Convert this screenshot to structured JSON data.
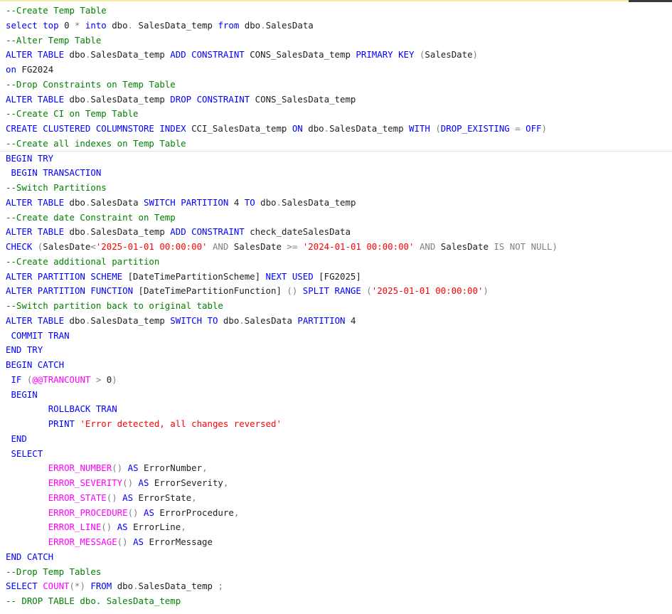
{
  "editor": {
    "lines": [
      {
        "indent": "",
        "tokens": [
          {
            "t": "--Create Temp Table",
            "c": "cm"
          }
        ]
      },
      {
        "indent": "",
        "tokens": [
          {
            "t": "select top ",
            "c": "kw"
          },
          {
            "t": "0 ",
            "c": "id"
          },
          {
            "t": "* ",
            "c": "op"
          },
          {
            "t": "into ",
            "c": "kw"
          },
          {
            "t": "dbo",
            "c": "id"
          },
          {
            "t": ".",
            "c": "op"
          },
          {
            "t": " SalesData_temp ",
            "c": "id"
          },
          {
            "t": "from ",
            "c": "kw"
          },
          {
            "t": "dbo",
            "c": "id"
          },
          {
            "t": ".",
            "c": "op"
          },
          {
            "t": "SalesData",
            "c": "id"
          }
        ]
      },
      {
        "indent": "",
        "tokens": [
          {
            "t": "--Alter Temp Table",
            "c": "cm"
          }
        ]
      },
      {
        "indent": "",
        "tokens": [
          {
            "t": "ALTER TABLE ",
            "c": "kw"
          },
          {
            "t": "dbo",
            "c": "id"
          },
          {
            "t": ".",
            "c": "op"
          },
          {
            "t": "SalesData_temp ",
            "c": "id"
          },
          {
            "t": "ADD CONSTRAINT ",
            "c": "kw"
          },
          {
            "t": "CONS_SalesData_temp ",
            "c": "id"
          },
          {
            "t": "PRIMARY KEY ",
            "c": "kw"
          },
          {
            "t": "(",
            "c": "op"
          },
          {
            "t": "SalesDate",
            "c": "id"
          },
          {
            "t": ")",
            "c": "op"
          }
        ]
      },
      {
        "indent": "",
        "tokens": [
          {
            "t": "on ",
            "c": "kw"
          },
          {
            "t": "FG2024",
            "c": "id"
          }
        ]
      },
      {
        "indent": "",
        "tokens": [
          {
            "t": "--Drop Constraints on Temp Table",
            "c": "cm"
          }
        ]
      },
      {
        "indent": "",
        "tokens": [
          {
            "t": "ALTER TABLE ",
            "c": "kw"
          },
          {
            "t": "dbo",
            "c": "id"
          },
          {
            "t": ".",
            "c": "op"
          },
          {
            "t": "SalesData_temp ",
            "c": "id"
          },
          {
            "t": "DROP CONSTRAINT ",
            "c": "kw"
          },
          {
            "t": "CONS_SalesData_temp",
            "c": "id"
          }
        ]
      },
      {
        "indent": "",
        "tokens": [
          {
            "t": "--Create CI on Temp Table",
            "c": "cm"
          }
        ]
      },
      {
        "indent": "",
        "tokens": [
          {
            "t": "CREATE CLUSTERED COLUMNSTORE INDEX ",
            "c": "kw"
          },
          {
            "t": "CCI_SalesData_temp ",
            "c": "id"
          },
          {
            "t": "ON ",
            "c": "kw"
          },
          {
            "t": "dbo",
            "c": "id"
          },
          {
            "t": ".",
            "c": "op"
          },
          {
            "t": "SalesData_temp ",
            "c": "id"
          },
          {
            "t": "WITH ",
            "c": "kw"
          },
          {
            "t": "(",
            "c": "op"
          },
          {
            "t": "DROP_EXISTING ",
            "c": "kw"
          },
          {
            "t": "= ",
            "c": "op"
          },
          {
            "t": "OFF",
            "c": "kw"
          },
          {
            "t": ")",
            "c": "op"
          }
        ]
      },
      {
        "indent": "",
        "tokens": [
          {
            "t": "--Create all indexes on Temp Table",
            "c": "cm"
          }
        ],
        "current": true
      },
      {
        "indent": "",
        "tokens": [
          {
            "t": "BEGIN TRY",
            "c": "kw"
          }
        ]
      },
      {
        "indent": " ",
        "tokens": [
          {
            "t": "BEGIN TRANSACTION",
            "c": "kw"
          }
        ]
      },
      {
        "indent": "",
        "tokens": [
          {
            "t": "--Switch Partitions",
            "c": "cm"
          }
        ]
      },
      {
        "indent": "",
        "tokens": [
          {
            "t": "ALTER TABLE ",
            "c": "kw"
          },
          {
            "t": "dbo",
            "c": "id"
          },
          {
            "t": ".",
            "c": "op"
          },
          {
            "t": "SalesData ",
            "c": "id"
          },
          {
            "t": "SWITCH PARTITION ",
            "c": "kw"
          },
          {
            "t": "4 ",
            "c": "id"
          },
          {
            "t": "TO ",
            "c": "kw"
          },
          {
            "t": "dbo",
            "c": "id"
          },
          {
            "t": ".",
            "c": "op"
          },
          {
            "t": "SalesData_temp",
            "c": "id"
          }
        ]
      },
      {
        "indent": "",
        "tokens": [
          {
            "t": "--Create date Constraint on Temp",
            "c": "cm"
          }
        ]
      },
      {
        "indent": "",
        "tokens": [
          {
            "t": "ALTER TABLE ",
            "c": "kw"
          },
          {
            "t": "dbo",
            "c": "id"
          },
          {
            "t": ".",
            "c": "op"
          },
          {
            "t": "SalesData_temp ",
            "c": "id"
          },
          {
            "t": "ADD CONSTRAINT ",
            "c": "kw"
          },
          {
            "t": "check_dateSalesData",
            "c": "id"
          }
        ]
      },
      {
        "indent": "",
        "tokens": [
          {
            "t": "CHECK ",
            "c": "kw"
          },
          {
            "t": "(",
            "c": "op"
          },
          {
            "t": "SalesDate",
            "c": "id"
          },
          {
            "t": "<",
            "c": "op"
          },
          {
            "t": "'2025-01-01 00:00:00' ",
            "c": "st"
          },
          {
            "t": "AND ",
            "c": "op"
          },
          {
            "t": "SalesDate ",
            "c": "id"
          },
          {
            "t": ">= ",
            "c": "op"
          },
          {
            "t": "'2024-01-01 00:00:00' ",
            "c": "st"
          },
          {
            "t": "AND ",
            "c": "op"
          },
          {
            "t": "SalesDate ",
            "c": "id"
          },
          {
            "t": "IS NOT NULL",
            "c": "op"
          },
          {
            "t": ")",
            "c": "op"
          }
        ]
      },
      {
        "indent": "",
        "tokens": [
          {
            "t": "--Create additional partition",
            "c": "cm"
          }
        ]
      },
      {
        "indent": "",
        "tokens": [
          {
            "t": "ALTER PARTITION SCHEME ",
            "c": "kw"
          },
          {
            "t": "[DateTimePartitionScheme] ",
            "c": "id"
          },
          {
            "t": "NEXT USED ",
            "c": "kw"
          },
          {
            "t": "[FG2025]",
            "c": "id"
          }
        ]
      },
      {
        "indent": "",
        "tokens": [
          {
            "t": "ALTER PARTITION FUNCTION ",
            "c": "kw"
          },
          {
            "t": "[DateTimePartitionFunction] ",
            "c": "id"
          },
          {
            "t": "() ",
            "c": "op"
          },
          {
            "t": "SPLIT RANGE ",
            "c": "kw"
          },
          {
            "t": "(",
            "c": "op"
          },
          {
            "t": "'2025-01-01 00:00:00'",
            "c": "st"
          },
          {
            "t": ")",
            "c": "op"
          }
        ]
      },
      {
        "indent": "",
        "tokens": [
          {
            "t": "--Switch partition back to original table",
            "c": "cm"
          }
        ]
      },
      {
        "indent": "",
        "tokens": [
          {
            "t": "ALTER TABLE ",
            "c": "kw"
          },
          {
            "t": "dbo",
            "c": "id"
          },
          {
            "t": ".",
            "c": "op"
          },
          {
            "t": "SalesData_temp ",
            "c": "id"
          },
          {
            "t": "SWITCH TO ",
            "c": "kw"
          },
          {
            "t": "dbo",
            "c": "id"
          },
          {
            "t": ".",
            "c": "op"
          },
          {
            "t": "SalesData ",
            "c": "id"
          },
          {
            "t": "PARTITION ",
            "c": "kw"
          },
          {
            "t": "4",
            "c": "id"
          }
        ]
      },
      {
        "indent": " ",
        "tokens": [
          {
            "t": "COMMIT TRAN",
            "c": "kw"
          }
        ]
      },
      {
        "indent": "",
        "tokens": [
          {
            "t": "END TRY",
            "c": "kw"
          }
        ]
      },
      {
        "indent": "",
        "tokens": [
          {
            "t": "BEGIN CATCH",
            "c": "kw"
          }
        ]
      },
      {
        "indent": " ",
        "tokens": [
          {
            "t": "IF ",
            "c": "kw"
          },
          {
            "t": "(",
            "c": "op"
          },
          {
            "t": "@@TRANCOUNT ",
            "c": "fn"
          },
          {
            "t": "> ",
            "c": "op"
          },
          {
            "t": "0",
            "c": "id"
          },
          {
            "t": ")",
            "c": "op"
          }
        ]
      },
      {
        "indent": " ",
        "tokens": [
          {
            "t": "BEGIN",
            "c": "kw"
          }
        ]
      },
      {
        "indent": "        ",
        "tokens": [
          {
            "t": "ROLLBACK TRAN",
            "c": "kw"
          }
        ]
      },
      {
        "indent": "        ",
        "tokens": [
          {
            "t": "PRINT ",
            "c": "kw"
          },
          {
            "t": "'Error detected, all changes reversed'",
            "c": "st"
          }
        ]
      },
      {
        "indent": " ",
        "tokens": [
          {
            "t": "END",
            "c": "kw"
          }
        ]
      },
      {
        "indent": " ",
        "tokens": [
          {
            "t": "SELECT",
            "c": "kw"
          }
        ]
      },
      {
        "indent": "        ",
        "tokens": [
          {
            "t": "ERROR_NUMBER",
            "c": "fn"
          },
          {
            "t": "() ",
            "c": "op"
          },
          {
            "t": "AS ",
            "c": "kw"
          },
          {
            "t": "ErrorNumber",
            "c": "id"
          },
          {
            "t": ",",
            "c": "op"
          }
        ]
      },
      {
        "indent": "        ",
        "tokens": [
          {
            "t": "ERROR_SEVERITY",
            "c": "fn"
          },
          {
            "t": "() ",
            "c": "op"
          },
          {
            "t": "AS ",
            "c": "kw"
          },
          {
            "t": "ErrorSeverity",
            "c": "id"
          },
          {
            "t": ",",
            "c": "op"
          }
        ]
      },
      {
        "indent": "        ",
        "tokens": [
          {
            "t": "ERROR_STATE",
            "c": "fn"
          },
          {
            "t": "() ",
            "c": "op"
          },
          {
            "t": "AS ",
            "c": "kw"
          },
          {
            "t": "ErrorState",
            "c": "id"
          },
          {
            "t": ",",
            "c": "op"
          }
        ]
      },
      {
        "indent": "        ",
        "tokens": [
          {
            "t": "ERROR_PROCEDURE",
            "c": "fn"
          },
          {
            "t": "() ",
            "c": "op"
          },
          {
            "t": "AS ",
            "c": "kw"
          },
          {
            "t": "ErrorProcedure",
            "c": "id"
          },
          {
            "t": ",",
            "c": "op"
          }
        ]
      },
      {
        "indent": "        ",
        "tokens": [
          {
            "t": "ERROR_LINE",
            "c": "fn"
          },
          {
            "t": "() ",
            "c": "op"
          },
          {
            "t": "AS ",
            "c": "kw"
          },
          {
            "t": "ErrorLine",
            "c": "id"
          },
          {
            "t": ",",
            "c": "op"
          }
        ]
      },
      {
        "indent": "        ",
        "tokens": [
          {
            "t": "ERROR_MESSAGE",
            "c": "fn"
          },
          {
            "t": "() ",
            "c": "op"
          },
          {
            "t": "AS ",
            "c": "kw"
          },
          {
            "t": "ErrorMessage",
            "c": "id"
          }
        ]
      },
      {
        "indent": "",
        "tokens": [
          {
            "t": "END CATCH",
            "c": "kw"
          }
        ]
      },
      {
        "indent": "",
        "tokens": [
          {
            "t": "--Drop Temp Tables",
            "c": "cm"
          }
        ]
      },
      {
        "indent": "",
        "tokens": [
          {
            "t": "SELECT ",
            "c": "kw"
          },
          {
            "t": "COUNT",
            "c": "fn"
          },
          {
            "t": "(*) ",
            "c": "op"
          },
          {
            "t": "FROM ",
            "c": "kw"
          },
          {
            "t": "dbo",
            "c": "id"
          },
          {
            "t": ".",
            "c": "op"
          },
          {
            "t": "SalesData_temp ",
            "c": "id"
          },
          {
            "t": ";",
            "c": "op"
          }
        ]
      },
      {
        "indent": "",
        "tokens": [
          {
            "t": "-- DROP TABLE dbo. SalesData_temp",
            "c": "cm"
          }
        ]
      }
    ]
  }
}
